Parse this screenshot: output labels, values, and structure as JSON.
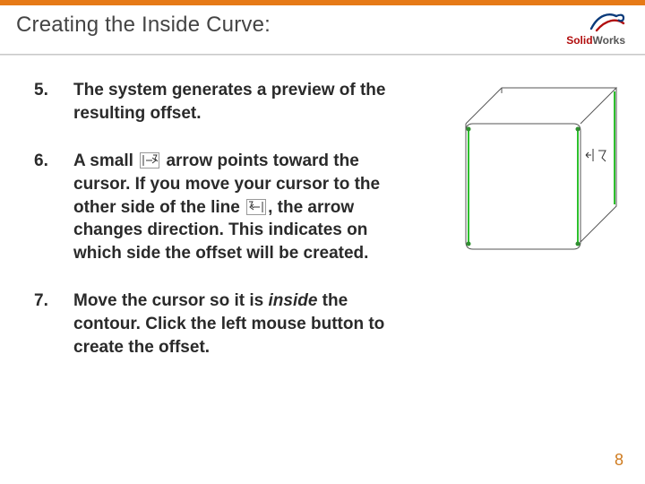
{
  "accent": "#e67a17",
  "title": "Creating the Inside Curve:",
  "logo": {
    "brand_a": "Solid",
    "brand_b": "Works"
  },
  "steps": [
    {
      "n": "5.",
      "parts": [
        {
          "t": "The system generates a preview of the resulting offset."
        }
      ]
    },
    {
      "n": "6.",
      "parts": [
        {
          "t": "A small "
        },
        {
          "icon": "arrow-out"
        },
        {
          "t": " arrow  points toward the cursor. If you move your cursor to the other side of the line "
        },
        {
          "icon": "arrow-in"
        },
        {
          "t": ", the arrow changes direction. This indicates on which side the offset will be created."
        }
      ]
    },
    {
      "n": "7.",
      "parts": [
        {
          "t": "Move the cursor so it is "
        },
        {
          "t": "inside",
          "italic": true
        },
        {
          "t": " the contour. Click the left mouse button to create the offset."
        }
      ]
    }
  ],
  "page_number": "8",
  "figure": {
    "alt": "Isometric cube preview with green offset edges and cursor arrow indicator"
  }
}
